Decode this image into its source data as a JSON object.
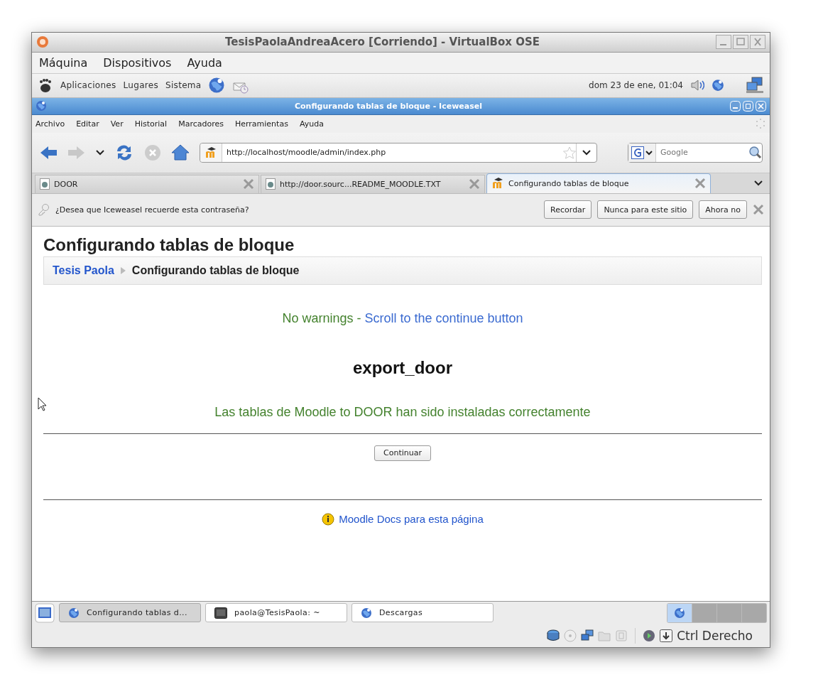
{
  "vbox_window": {
    "title": "TesisPaolaAndreaAcero [Corriendo] - VirtualBox OSE"
  },
  "vbox_menu": [
    "Máquina",
    "Dispositivos",
    "Ayuda"
  ],
  "gnome_panel": {
    "menus": [
      "Aplicaciones",
      "Lugares",
      "Sistema"
    ],
    "clock": "dom 23 de ene, 01:04"
  },
  "browser": {
    "title": "Configurando tablas de bloque - Iceweasel",
    "menu": [
      "Archivo",
      "Editar",
      "Ver",
      "Historial",
      "Marcadores",
      "Herramientas",
      "Ayuda"
    ],
    "url": "http://localhost/moodle/admin/index.php",
    "search": {
      "placeholder": "Google"
    },
    "tabs": [
      {
        "label": "DOOR",
        "kind": "page",
        "selected": false
      },
      {
        "label": "http://door.sourc...README_MOODLE.TXT",
        "kind": "page",
        "selected": false
      },
      {
        "label": "Configurando tablas de bloque",
        "kind": "moodle",
        "selected": true
      }
    ],
    "password_bar": {
      "message": "¿Desea que Iceweasel recuerde esta contraseña?",
      "buttons": [
        "Recordar",
        "Nunca para este sitio",
        "Ahora no"
      ]
    }
  },
  "page": {
    "heading": "Configurando tablas de bloque",
    "breadcrumb": [
      {
        "label": "Tesis Paola",
        "kind": "link"
      },
      {
        "label": "Configurando tablas de bloque",
        "kind": "current"
      }
    ],
    "warnings": {
      "text": "No warnings - ",
      "link": "Scroll to the continue button"
    },
    "plugin": "export_door",
    "success": "Las tablas de Moodle to DOOR han sido instaladas correctamente",
    "continue_button": "Continuar",
    "docs_link": "Moodle Docs para esta página"
  },
  "taskbar": [
    {
      "label": "Configurando tablas d...",
      "kind": "browser",
      "selected": true
    },
    {
      "label": "paola@TesisPaola: ~",
      "kind": "terminal",
      "selected": false
    },
    {
      "label": "Descargas",
      "kind": "browser",
      "selected": false
    }
  ],
  "workspaces": [
    {
      "selected": true
    },
    {
      "selected": false
    },
    {
      "selected": false
    },
    {
      "selected": false
    }
  ],
  "status_bar": {
    "host_key": "Ctrl Derecho"
  }
}
